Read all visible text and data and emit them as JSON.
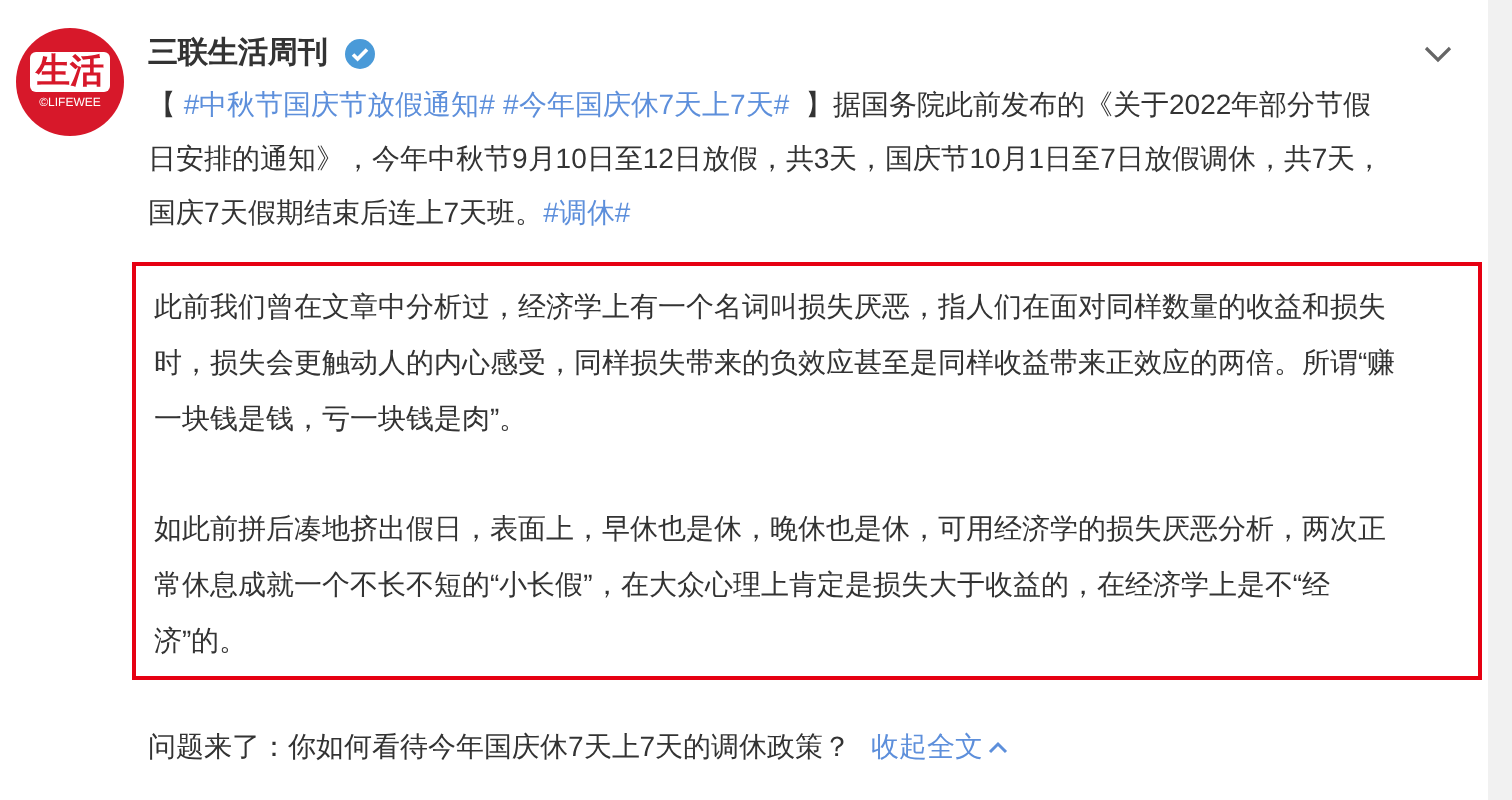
{
  "account": {
    "logo_text": "生活",
    "logo_subtext": "©LIFEWEE",
    "name": "三联生活周刊"
  },
  "post": {
    "segments": [
      {
        "kind": "text",
        "text": "【 "
      },
      {
        "kind": "tag",
        "text": "#中秋节国庆节放假通知#"
      },
      {
        "kind": "tag",
        "text": "#今年国庆休7天上7天#"
      },
      {
        "kind": "text",
        "text": " 】据国务院此前发布的《关于2022年部分节假日安排的通知》，今年中秋节9月10日至12日放假，共3天，国庆节10月1日至7日放假调休，共7天，国庆7天假期结束后连上7天班。"
      },
      {
        "kind": "tag",
        "text": "#调休#"
      }
    ]
  },
  "quote": {
    "paragraphs": [
      "此前我们曾在文章中分析过，经济学上有一个名词叫损失厌恶，指人们在面对同样数量的收益和损失时，损失会更触动人的内心感受，同样损失带来的负效应甚至是同样收益带来正效应的两倍。所谓“赚一块钱是钱，亏一块钱是肉”。",
      "如此前拼后凑地挤出假日，表面上，早休也是休，晚休也是休，可用经济学的损失厌恶分析，两次正常休息成就一个不长不短的“小长假”，在大众心理上肯定是损失大于收益的，在经济学上是不“经济”的。"
    ]
  },
  "footer": {
    "question": "问题来了：你如何看待今年国庆休7天上7天的调休政策？",
    "collapse_link": "收起全文"
  }
}
